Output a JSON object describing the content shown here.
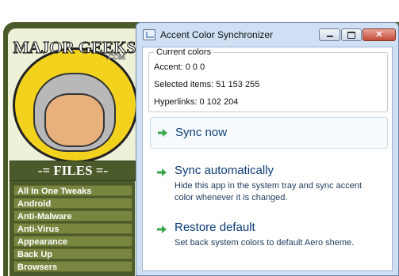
{
  "window": {
    "title": "Accent Color Synchronizer",
    "minimize_label": "minimize",
    "maximize_label": "maximize",
    "close_label": "close"
  },
  "current_colors": {
    "legend": "Current colors",
    "accent": "Accent: 0 0 0",
    "selected_items": "Selected items: 51 153 255",
    "hyperlinks": "Hyperlinks: 0 102 204"
  },
  "commands": [
    {
      "title": "Sync now",
      "description": ""
    },
    {
      "title": "Sync automatically",
      "description": "Hide this app in the system tray and sync accent color whenever it is changed."
    },
    {
      "title": "Restore default",
      "description": "Set back system colors to default Aero sheme."
    }
  ],
  "background_site": {
    "logo_text": "MAJOR GEEKS",
    "logo_suffix": ".COM",
    "files_heading": "-= FILES =-",
    "categories": [
      "All In One Tweaks",
      "Android",
      "Anti-Malware",
      "Anti-Virus",
      "Appearance",
      "Back Up",
      "Browsers"
    ]
  },
  "colors": {
    "command_link_text": "#0b3b75",
    "arrow_green": "#3aa64a",
    "site_dark_green": "#4b5a2a",
    "site_item_green": "#79863f",
    "logo_yellow": "#f3d21d"
  }
}
